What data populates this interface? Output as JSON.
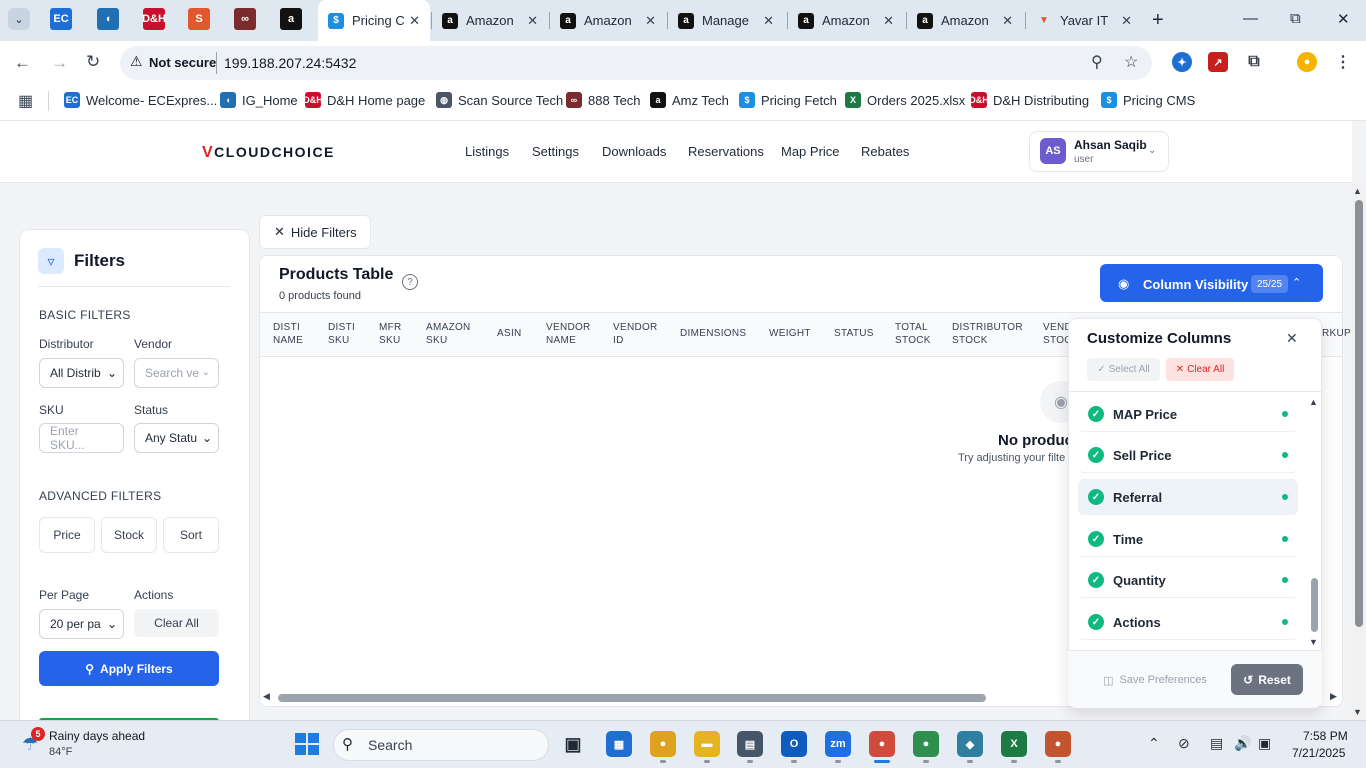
{
  "browser": {
    "tabs": [
      {
        "title": "Pricing C",
        "active": true,
        "icon": "pricing-icon"
      },
      {
        "title": "Amazon",
        "icon": "amazon-icon"
      },
      {
        "title": "Amazon",
        "icon": "amazon-icon"
      },
      {
        "title": "Manage",
        "icon": "amazon-icon"
      },
      {
        "title": "Amazon",
        "icon": "amazon-icon"
      },
      {
        "title": "Amazon",
        "icon": "amazon-icon"
      },
      {
        "title": "Yavar IT",
        "icon": "maps-icon"
      }
    ],
    "pinned_tabs": [
      {
        "icon": "ec-icon",
        "glyph": "EC",
        "color": "#1d6fd6"
      },
      {
        "icon": "ig-icon",
        "glyph": "◖",
        "color": "#1f6fb2"
      },
      {
        "icon": "dh-icon",
        "glyph": "D&H",
        "color": "#c8102e"
      },
      {
        "icon": "scansource-icon",
        "glyph": "S",
        "color": "#e2572c"
      },
      {
        "icon": "888-icon",
        "glyph": "∞",
        "color": "#7a2b2b"
      },
      {
        "icon": "amazon-icon",
        "glyph": "a",
        "color": "#111111"
      }
    ],
    "address": {
      "security": "Not secure",
      "url": "199.188.207.24:5432"
    },
    "bookmarks": [
      {
        "label": "Welcome- ECExpres...",
        "icon": "ec-icon",
        "glyph": "EC",
        "color": "#1d6fd6"
      },
      {
        "label": "IG_Home",
        "icon": "ig-icon",
        "glyph": "◖",
        "color": "#1f6fb2"
      },
      {
        "label": "D&H Home page",
        "icon": "dh-icon",
        "glyph": "D&H",
        "color": "#c8102e"
      },
      {
        "label": "Scan Source Tech",
        "icon": "globe-icon",
        "glyph": "◍",
        "color": "#4b5563"
      },
      {
        "label": "888 Tech",
        "icon": "888-icon",
        "glyph": "∞",
        "color": "#7a2b2b"
      },
      {
        "label": "Amz Tech",
        "icon": "amazon-icon",
        "glyph": "a",
        "color": "#111111"
      },
      {
        "label": "Pricing Fetch",
        "icon": "pricing-icon",
        "glyph": "$",
        "color": "#1d8fe0"
      },
      {
        "label": "Orders 2025.xlsx",
        "icon": "excel-icon",
        "glyph": "X",
        "color": "#1d7a45"
      },
      {
        "label": "D&H Distributing",
        "icon": "dh-icon",
        "glyph": "D&H",
        "color": "#c8102e"
      },
      {
        "label": "Pricing CMS",
        "icon": "pricing-icon",
        "glyph": "$",
        "color": "#1d8fe0"
      }
    ]
  },
  "app": {
    "logo_mark": "V",
    "logo_text": "CLOUDCHOICE",
    "nav": [
      "Listings",
      "Settings",
      "Downloads",
      "Reservations",
      "Map Price",
      "Rebates"
    ],
    "user": {
      "initials": "AS",
      "name": "Ahsan Saqib",
      "role": "user"
    }
  },
  "filters": {
    "title": "Filters",
    "basic_title": "BASIC FILTERS",
    "distributor_label": "Distributor",
    "distributor_value": "All Distrib",
    "vendor_label": "Vendor",
    "vendor_placeholder": "Search ve",
    "sku_label": "SKU",
    "sku_placeholder": "Enter SKU...",
    "status_label": "Status",
    "status_value": "Any Statu",
    "advanced_title": "ADVANCED FILTERS",
    "advanced_buttons": [
      "Price",
      "Stock",
      "Sort"
    ],
    "per_page_label": "Per Page",
    "per_page_value": "20 per pa",
    "actions_label": "Actions",
    "clear_all": "Clear All",
    "apply": "Apply Filters"
  },
  "table": {
    "hide_filters": "Hide Filters",
    "title": "Products Table",
    "subtitle": "0 products found",
    "columns": [
      [
        "DISTI",
        "NAME"
      ],
      [
        "DISTI",
        "SKU"
      ],
      [
        "MFR",
        "SKU"
      ],
      [
        "AMAZON",
        "SKU"
      ],
      [
        "ASIN",
        ""
      ],
      [
        "VENDOR",
        "NAME"
      ],
      [
        "VENDOR",
        "ID"
      ],
      [
        "DIMENSIONS",
        ""
      ],
      [
        "WEIGHT",
        ""
      ],
      [
        "STATUS",
        ""
      ],
      [
        "TOTAL",
        "STOCK"
      ],
      [
        "DISTRIBUTOR",
        "STOCK"
      ],
      [
        "VEND",
        "STOC"
      ]
    ],
    "peek_column": "RKUP",
    "empty_title": "No produc",
    "empty_subtitle": "Try adjusting your filte"
  },
  "column_visibility": {
    "button_label": "Column Visibility",
    "count": "25/25",
    "panel_title": "Customize Columns",
    "select_all": "Select All",
    "clear_all": "Clear All",
    "items": [
      "MAP Price",
      "Sell Price",
      "Referral",
      "Time",
      "Quantity",
      "Actions"
    ],
    "highlighted_item": "Referral",
    "save": "Save Preferences",
    "reset": "Reset",
    "colors": {
      "primary": "#2563eb",
      "check": "#10b981",
      "danger": "#dc2626"
    }
  },
  "taskbar": {
    "weather_title": "Rainy days ahead",
    "weather_temp": "84°F",
    "weather_badge": "5",
    "search_placeholder": "Search",
    "apps": [
      {
        "icon": "taskview-icon",
        "glyph": "▣",
        "color": "#1f2937"
      },
      {
        "icon": "store-icon",
        "glyph": "▦",
        "color": "#1e6fd0"
      },
      {
        "icon": "chrome-icon",
        "glyph": "●",
        "color": "#e0a020"
      },
      {
        "icon": "folder-icon",
        "glyph": "▬",
        "color": "#e6b422"
      },
      {
        "icon": "calculator-icon",
        "glyph": "▤",
        "color": "#475569"
      },
      {
        "icon": "outlook-icon",
        "glyph": "O",
        "color": "#0f5cbf"
      },
      {
        "icon": "zoom-icon",
        "glyph": "zm",
        "color": "#1f6fe0"
      },
      {
        "icon": "chrome-profile-icon",
        "glyph": "●",
        "color": "#d14b3c"
      },
      {
        "icon": "chrome-profile2-icon",
        "glyph": "●",
        "color": "#2f8f4e"
      },
      {
        "icon": "app-icon",
        "glyph": "◆",
        "color": "#2f7fa0"
      },
      {
        "icon": "excel-icon",
        "glyph": "X",
        "color": "#1d7a45"
      },
      {
        "icon": "chrome-profile3-icon",
        "glyph": "●",
        "color": "#c2552f"
      }
    ],
    "time": "7:58 PM",
    "date": "7/21/2025"
  }
}
